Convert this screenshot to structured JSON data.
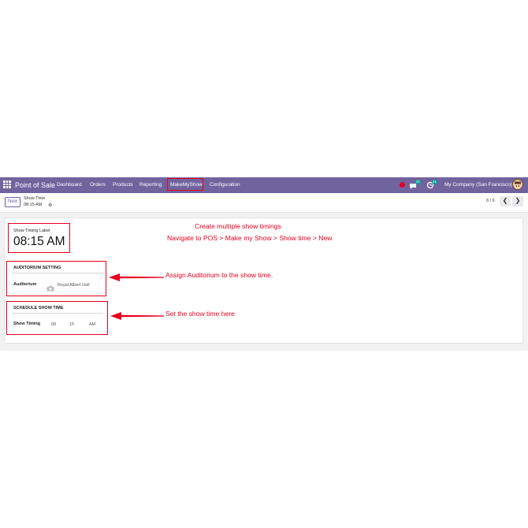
{
  "navbar": {
    "brand": "Point of Sale",
    "menu": [
      "Dashboard",
      "Orders",
      "Products",
      "Reporting",
      "MakeMyShow",
      "Configuration"
    ],
    "chat_count": "21",
    "activity_count": "41",
    "company": "My Company (San Francisco)"
  },
  "control_panel": {
    "new_label": "New",
    "breadcrumb_parent": "Show Time",
    "breadcrumb_current": "08:15 AM",
    "pager": "8 / 9"
  },
  "form": {
    "show_timing_label": "Show Timing Label",
    "show_timing_value": "08:15 AM",
    "auditorium_section": "AUDITORIUM SETTING",
    "auditorium_label": "Auditorium",
    "auditorium_value": "Royal Albert Hall",
    "schedule_section": "SCHEDULE SHOW TIME",
    "show_timing_field": "Show Timing",
    "hour": "08",
    "minute": "15",
    "ampm": "AM"
  },
  "annotations": {
    "title": "Create multiple show timings",
    "path": "Navigate to POS > Make my Show > Show time > New",
    "auditorium_note": "Assign Auditorium to the show time.",
    "time_note": "Set the show time here"
  },
  "colors": {
    "navbar": "#71639e",
    "annotation_red": "#e8001f",
    "badge_green": "#00a09d"
  }
}
